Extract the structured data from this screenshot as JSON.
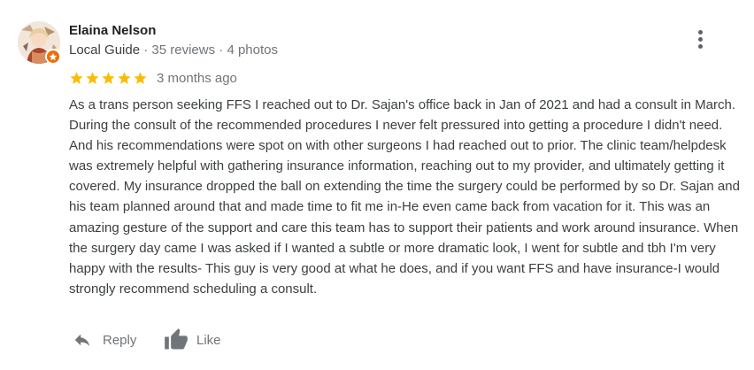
{
  "reviewer": {
    "name": "Elaina Nelson",
    "badge": "Local Guide",
    "separator": " · ",
    "reviews": "35 reviews",
    "photos": "4 photos",
    "avatar_icon": "user-avatar-icon",
    "badge_icon": "local-guide-star-icon"
  },
  "rating": {
    "stars": 5,
    "max": 5,
    "date": "3 months ago",
    "star_color": "#fbbc04"
  },
  "review_text": "As a trans person seeking FFS I reached out to Dr. Sajan's office back in Jan of 2021 and had a consult in March. During the consult of the recommended procedures I never felt pressured into getting a procedure I didn't need. And his recommendations were spot on with other surgeons I had reached out to prior. The clinic team/helpdesk was extremely helpful with gathering insurance information, reaching out to my provider, and ultimately getting it covered. My insurance dropped the ball on extending the time the surgery could be performed by so Dr. Sajan and his team planned around that and made time to fit me in-He even came back from vacation for it. This was an amazing gesture of the support and care this team has to support their patients and work around insurance. When the surgery day came I was asked if I wanted a subtle or more dramatic look, I went for subtle and tbh I'm very happy with the results- This guy is very good at what he does, and if you want FFS and have insurance-I would strongly recommend scheduling a consult.",
  "actions": {
    "reply_label": "Reply",
    "like_label": "Like",
    "reply_icon": "reply-arrow-icon",
    "like_icon": "thumbs-up-icon"
  },
  "menu_icon": "more-vertical-icon",
  "colors": {
    "name": "#202124",
    "secondary": "#70757a",
    "body": "#3c4043",
    "badge": "#e8710a"
  }
}
